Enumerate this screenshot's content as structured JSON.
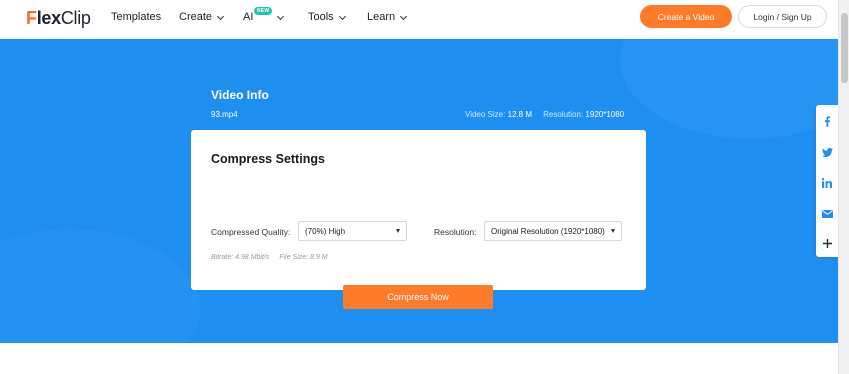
{
  "header": {
    "logo": {
      "mark": "F",
      "text1": "lex",
      "text2": "Clip"
    },
    "nav": [
      {
        "label": "Templates",
        "has_dropdown": false
      },
      {
        "label": "Create",
        "has_dropdown": true
      },
      {
        "label": "AI",
        "has_dropdown": true,
        "badge": "NEW"
      },
      {
        "label": "Tools",
        "has_dropdown": true
      },
      {
        "label": "Learn",
        "has_dropdown": true
      }
    ],
    "create_button": "Create a Video",
    "login_button": "Login / Sign Up"
  },
  "video_info": {
    "title": "Video Info",
    "filename": "93.mp4",
    "size_label": "Video Size:",
    "size_value": "12.8 M",
    "resolution_label": "Resolution:",
    "resolution_value": "1920*1080"
  },
  "compress": {
    "title": "Compress Settings",
    "quality_label": "Compressed Quality:",
    "quality_value": "(70%) High",
    "resolution_label": "Resolution:",
    "resolution_value": "Original Resolution (1920*1080)",
    "bitrate": "Bitrate: 4.98 Mbit/s",
    "file_size": "File Size: 8.9 M",
    "button": "Compress Now"
  },
  "share": [
    "facebook-icon",
    "twitter-icon",
    "linkedin-icon",
    "email-icon",
    "plus-icon"
  ],
  "colors": {
    "hero_bg": "#1f8ef1",
    "accent": "#ff7a29",
    "badge": "#1fc6b0",
    "share_icon": "#1f8ef1"
  }
}
